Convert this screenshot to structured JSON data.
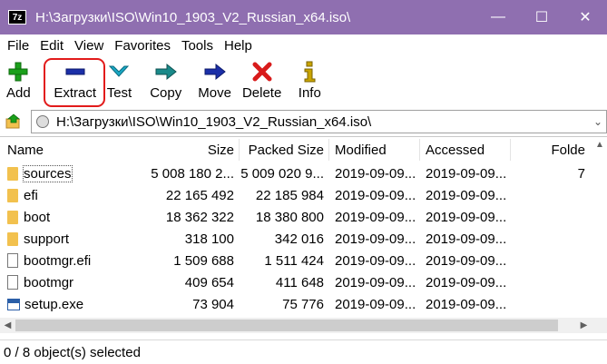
{
  "titlebar": {
    "app_icon_text": "7z",
    "title": "H:\\Загрузки\\ISO\\Win10_1903_V2_Russian_x64.iso\\",
    "minimize": "—",
    "maximize": "☐",
    "close": "✕"
  },
  "menu": [
    "File",
    "Edit",
    "View",
    "Favorites",
    "Tools",
    "Help"
  ],
  "toolbar": {
    "add": "Add",
    "extract": "Extract",
    "test": "Test",
    "copy": "Copy",
    "move": "Move",
    "delete": "Delete",
    "info": "Info",
    "colors": {
      "add": "#1aa01a",
      "extract": "#1b2fa8",
      "test": "#19a8c4",
      "copy": "#1a8a8a",
      "move": "#1b2fa8",
      "delete": "#d81b1b",
      "info": "#c9a400",
      "highlight": "#e21b1b"
    }
  },
  "address": {
    "path": "H:\\Загрузки\\ISO\\Win10_1903_V2_Russian_x64.iso\\"
  },
  "columns": {
    "name": "Name",
    "size": "Size",
    "packed": "Packed Size",
    "modified": "Modified",
    "accessed": "Accessed",
    "folders": "Folde"
  },
  "rows": [
    {
      "type": "folder",
      "name": "sources",
      "size": "5 008 180 2...",
      "packed": "5 009 020 9...",
      "modified": "2019-09-09...",
      "accessed": "2019-09-09...",
      "folders": "7"
    },
    {
      "type": "folder",
      "name": "efi",
      "size": "22 165 492",
      "packed": "22 185 984",
      "modified": "2019-09-09...",
      "accessed": "2019-09-09...",
      "folders": ""
    },
    {
      "type": "folder",
      "name": "boot",
      "size": "18 362 322",
      "packed": "18 380 800",
      "modified": "2019-09-09...",
      "accessed": "2019-09-09...",
      "folders": ""
    },
    {
      "type": "folder",
      "name": "support",
      "size": "318 100",
      "packed": "342 016",
      "modified": "2019-09-09...",
      "accessed": "2019-09-09...",
      "folders": ""
    },
    {
      "type": "file",
      "name": "bootmgr.efi",
      "size": "1 509 688",
      "packed": "1 511 424",
      "modified": "2019-09-09...",
      "accessed": "2019-09-09...",
      "folders": ""
    },
    {
      "type": "file",
      "name": "bootmgr",
      "size": "409 654",
      "packed": "411 648",
      "modified": "2019-09-09...",
      "accessed": "2019-09-09...",
      "folders": ""
    },
    {
      "type": "exe",
      "name": "setup.exe",
      "size": "73 904",
      "packed": "75 776",
      "modified": "2019-09-09...",
      "accessed": "2019-09-09...",
      "folders": ""
    }
  ],
  "status": "0 / 8 object(s) selected"
}
